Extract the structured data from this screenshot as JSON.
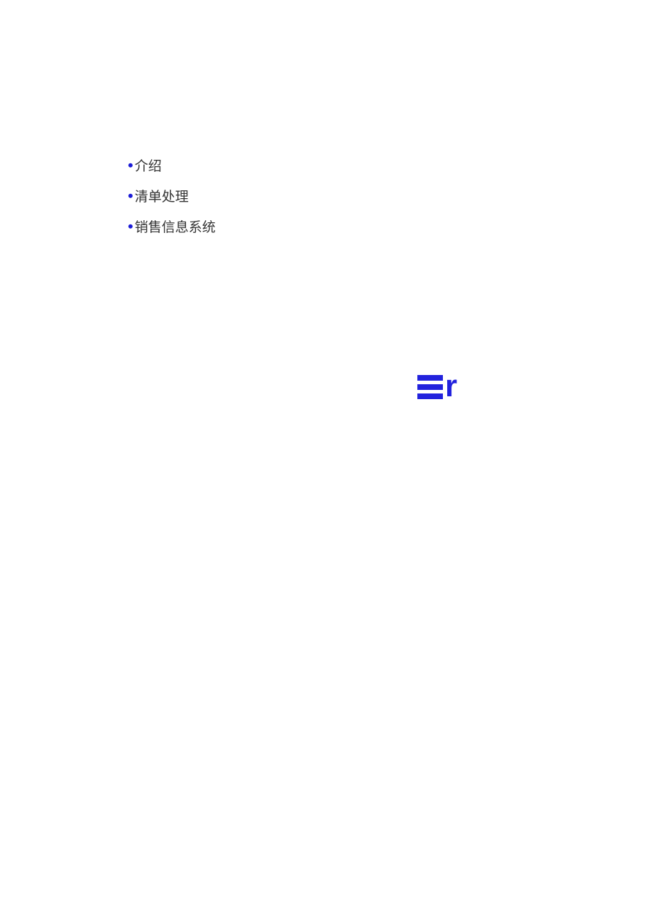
{
  "list": {
    "items": [
      {
        "label": "介绍"
      },
      {
        "label": "清单处理"
      },
      {
        "label": "销售信息系统"
      }
    ]
  },
  "logo": {
    "text": "r"
  }
}
